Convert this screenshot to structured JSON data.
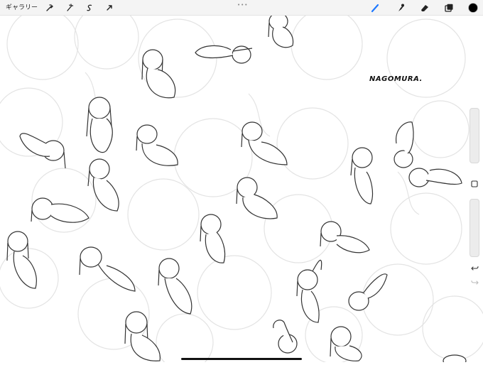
{
  "toolbar": {
    "gallery_label": "ギャラリー",
    "left_tools": [
      {
        "name": "wrench-icon"
      },
      {
        "name": "magic-wand-icon"
      },
      {
        "name": "selection-icon"
      },
      {
        "name": "transform-arrow-icon"
      }
    ],
    "right_tools": [
      {
        "name": "brush-icon",
        "active": true
      },
      {
        "name": "smudge-icon"
      },
      {
        "name": "eraser-icon"
      },
      {
        "name": "layers-icon"
      },
      {
        "name": "color-swatch"
      }
    ],
    "current_color": "#000000",
    "accent_color": "#1e78ff"
  },
  "canvas": {
    "signature": "NAGOMURA."
  },
  "sidebar": {
    "items": [
      {
        "name": "brush-size-slider"
      },
      {
        "name": "modify-button"
      },
      {
        "name": "opacity-slider"
      },
      {
        "name": "undo-icon"
      },
      {
        "name": "redo-icon"
      }
    ]
  }
}
